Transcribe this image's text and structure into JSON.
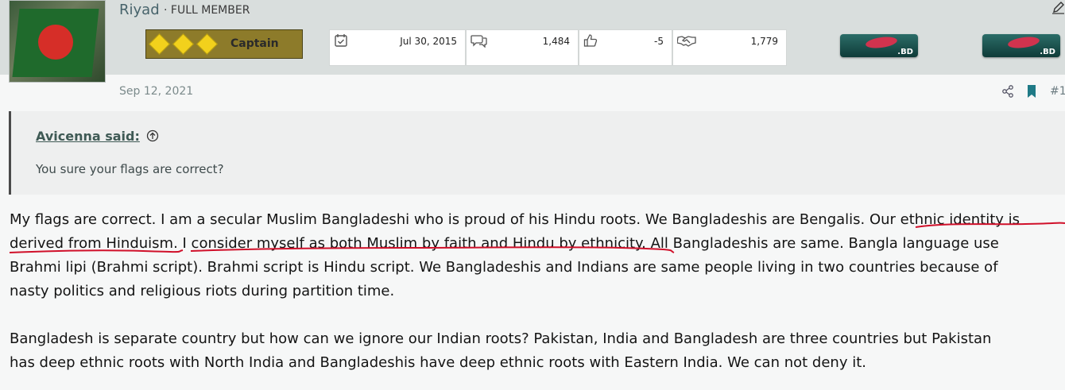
{
  "user": {
    "name": "Riyad",
    "title": "· FULL MEMBER",
    "rank_label": "Captain"
  },
  "stats": [
    {
      "icon": "calendar-check-icon",
      "value": "Jul 30, 2015"
    },
    {
      "icon": "message-bubbles-icon",
      "value": "1,484"
    },
    {
      "icon": "thumbs-up-icon",
      "value": "-5"
    },
    {
      "icon": "handshake-icon",
      "value": "1,779"
    }
  ],
  "flags": [
    {
      "label": ".BD"
    },
    {
      "label": ".BD"
    }
  ],
  "post": {
    "date": "Sep 12, 2021",
    "number": "#1"
  },
  "quote": {
    "author": "Avicenna said:",
    "text": "You sure your flags are correct?"
  },
  "body": {
    "lines": [
      "My flags are correct. I am a secular Muslim Bangladeshi who is proud of his Hindu roots. We Bangladeshis are Bengalis. Our ethnic identity is",
      "derived from Hinduism. I consider myself as both Muslim by faith and Hindu by ethnicity. All Bangladeshis are same. Bangla language use",
      "Brahmi lipi (Brahmi script). Brahmi script is Hindu script. We Bangladeshis and Indians are same people living in two countries because of",
      "nasty politics and religious riots during partition time.",
      "Bangladesh is separate country but how can we ignore our Indian roots? Pakistan, India and Bangladesh are three countries but Pakistan",
      "has deep ethnic roots with North India and Bangladeshis have deep ethnic roots with Eastern India. We can not deny it."
    ]
  },
  "colors": {
    "accent": "#47636b",
    "underline": "#d0102a",
    "rank_bg": "#8d7b2a"
  }
}
